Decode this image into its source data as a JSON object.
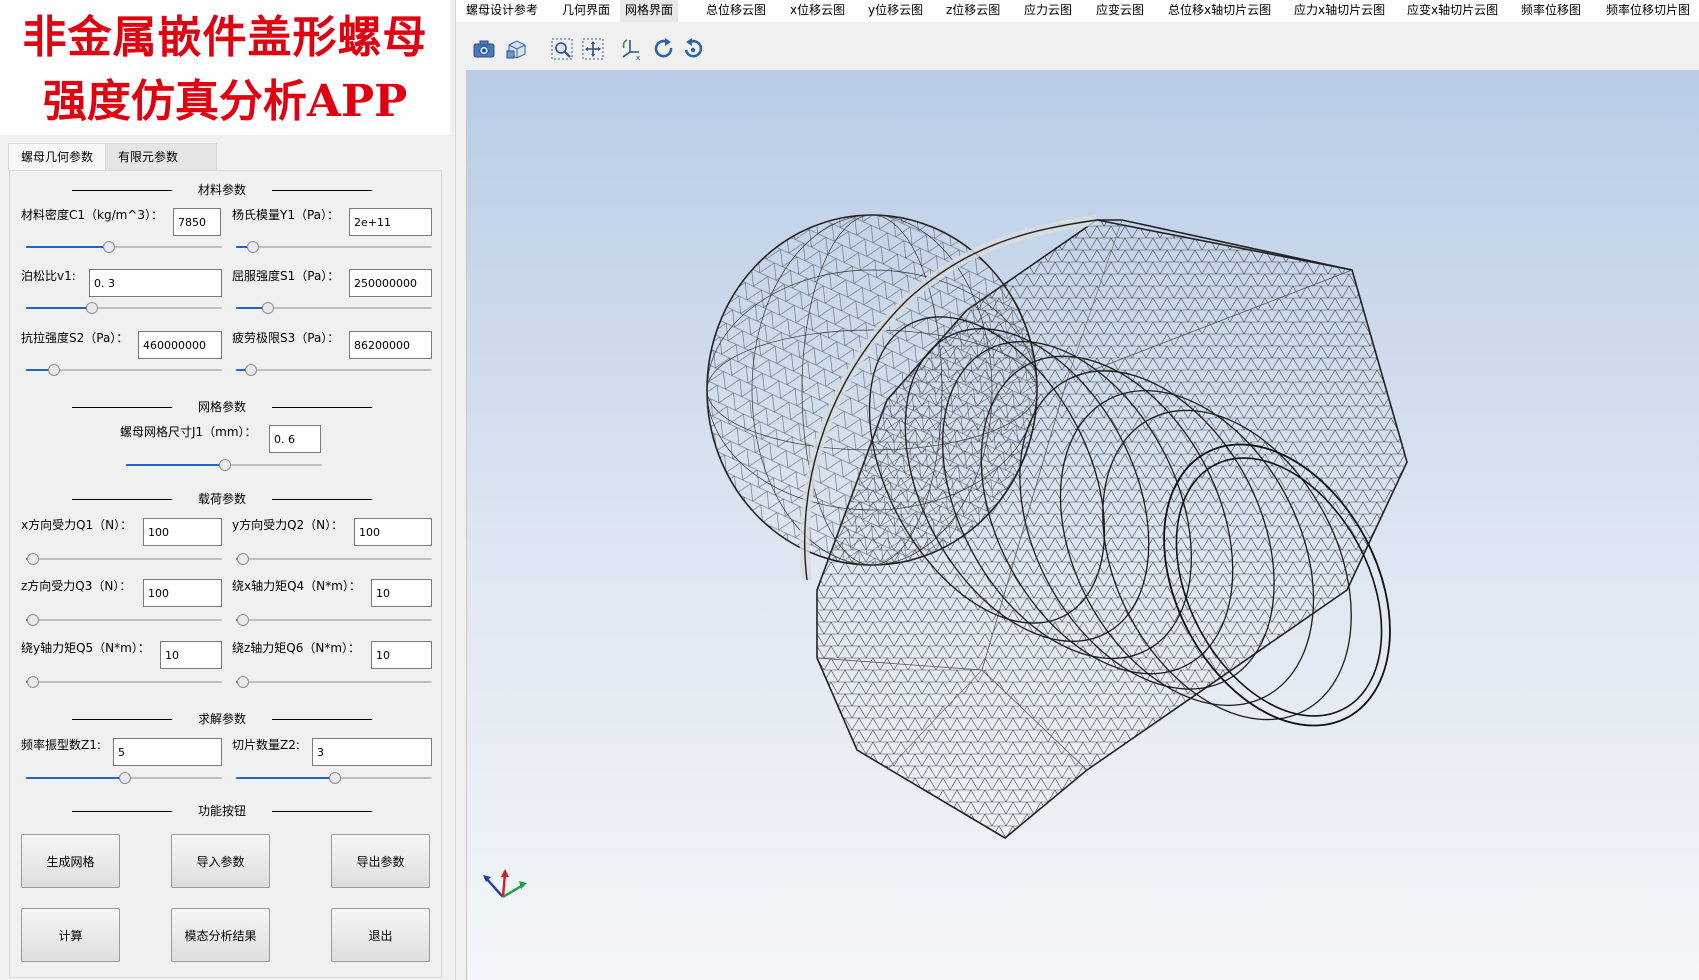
{
  "banner": {
    "line1": "非金属嵌件盖形螺母",
    "line2": "强度仿真分析APP"
  },
  "menu": [
    "螺母设计参考",
    "几何界面",
    "网格界面",
    "总位移云图",
    "x位移云图",
    "y位移云图",
    "z位移云图",
    "应力云图",
    "应变云图",
    "总位移x轴切片云图",
    "应力x轴切片云图",
    "应变x轴切片云图",
    "频率位移图",
    "频率位移切片图"
  ],
  "active_menu": "网格界面",
  "tabs": {
    "geometry": "螺母几何参数",
    "fem": "有限元参数"
  },
  "sections": {
    "material": "材料参数",
    "mesh": "网格参数",
    "load": "载荷参数",
    "solve": "求解参数",
    "functions": "功能按钮"
  },
  "fields": {
    "c1": {
      "label": "材料密度C1（kg/m^3）：",
      "value": "7850",
      "level": 0.42
    },
    "y1": {
      "label": "杨氏模量Y1（Pa）：",
      "value": "2e+11",
      "level": 0.08
    },
    "v1": {
      "label": "泊松比v1:",
      "value": "0. 3",
      "level": 0.33
    },
    "s1": {
      "label": "屈服强度S1（Pa）：",
      "value": "250000000",
      "level": 0.16
    },
    "s2": {
      "label": "抗拉强度S2（Pa）：",
      "value": "460000000",
      "level": 0.14
    },
    "s3": {
      "label": "疲劳极限S3（Pa）：",
      "value": "86200000",
      "level": 0.07
    },
    "j1": {
      "label": "螺母网格尺寸J1（mm）：",
      "value": "0. 6",
      "level": 0.5
    },
    "q1": {
      "label": "x方向受力Q1（N）：",
      "value": "100",
      "level": 0.03
    },
    "q2": {
      "label": "y方向受力Q2（N）：",
      "value": "100",
      "level": 0.03
    },
    "q3": {
      "label": "z方向受力Q3（N）：",
      "value": "100",
      "level": 0.03
    },
    "q4": {
      "label": "绕x轴力矩Q4（N*m）：",
      "value": "10",
      "level": 0.03
    },
    "q5": {
      "label": "绕y轴力矩Q5（N*m）：",
      "value": "10",
      "level": 0.03
    },
    "q6": {
      "label": "绕z轴力矩Q6（N*m）：",
      "value": "10",
      "level": 0.03
    },
    "z1": {
      "label": "频率振型数Z1:",
      "value": "5",
      "level": 0.5
    },
    "z2": {
      "label": "切片数量Z2:",
      "value": "3",
      "level": 0.5
    }
  },
  "buttons": {
    "generate_mesh": "生成网格",
    "import_params": "导入参数",
    "export_params": "导出参数",
    "compute": "计算",
    "modal_results": "模态分析结果",
    "exit": "退出"
  },
  "toolbar_icons": [
    "camera-icon",
    "view-cube-icon",
    "zoom-box-icon",
    "pan-icon",
    "axes-icon",
    "rotate-icon",
    "reset-view-icon"
  ],
  "colors": {
    "banner_text": "#e00010",
    "slider_fill": "#1e66c8",
    "viewport_top": "#b8cce6",
    "viewport_bottom": "#f4f6f9"
  }
}
